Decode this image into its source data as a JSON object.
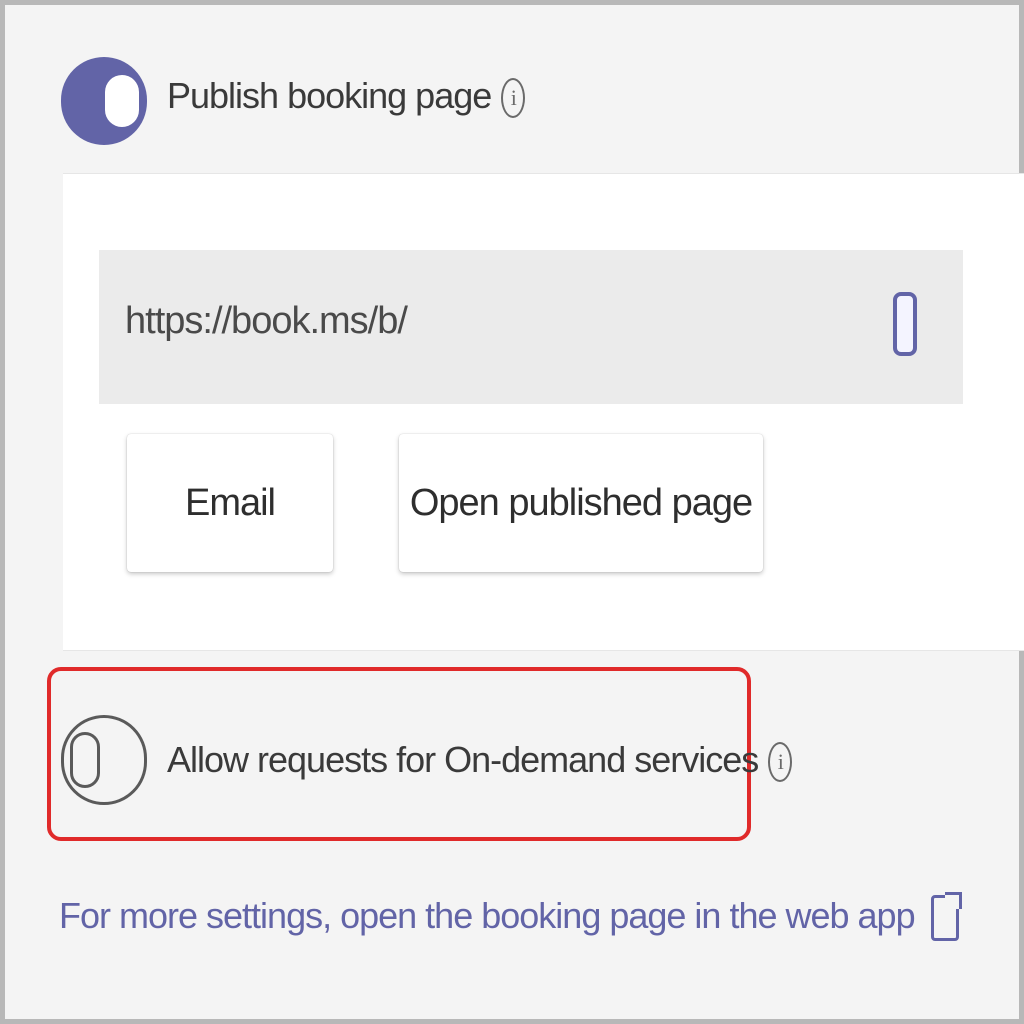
{
  "publish": {
    "label": "Publish booking page",
    "enabled": true,
    "info_icon": "info-icon"
  },
  "card": {
    "url_value": "https://book.ms/b/",
    "copy_icon": "copy-icon",
    "email_button": "Email",
    "open_button": "Open published page"
  },
  "ondemand": {
    "label": "Allow requests for On-demand services",
    "enabled": false,
    "info_icon": "info-icon",
    "highlight_color": "#e02a2a"
  },
  "footer": {
    "link_text": "For more settings, open the booking page in the web app",
    "link_icon": "external-link-icon"
  },
  "colors": {
    "accent": "#6264a7",
    "background": "#f4f4f4",
    "card": "#ffffff"
  }
}
